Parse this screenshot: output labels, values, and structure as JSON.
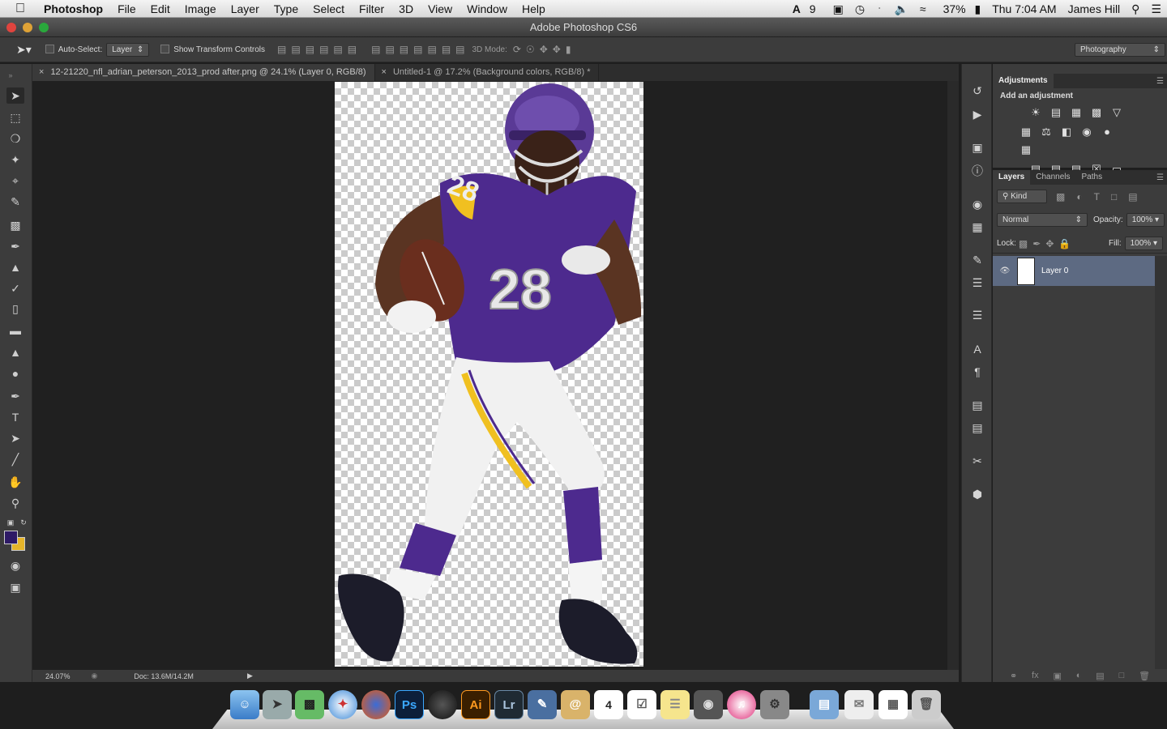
{
  "menubar": {
    "app": "Photoshop",
    "items": [
      "File",
      "Edit",
      "Image",
      "Layer",
      "Type",
      "Select",
      "Filter",
      "3D",
      "View",
      "Window",
      "Help"
    ],
    "status_badge": "9",
    "battery": "37%",
    "clock": "Thu 7:04 AM",
    "user": "James Hill"
  },
  "window": {
    "title": "Adobe Photoshop CS6"
  },
  "options": {
    "auto_select_label": "Auto-Select:",
    "auto_select_value": "Layer",
    "transform_label": "Show Transform Controls",
    "mode3d_label": "3D Mode:",
    "workspace": "Photography"
  },
  "tabs": [
    {
      "label": "12-21220_nfl_adrian_peterson_2013_prod after.png @ 24.1% (Layer 0, RGB/8)"
    },
    {
      "label": "Untitled-1 @ 17.2% (Background colors, RGB/8) *"
    }
  ],
  "status": {
    "zoom": "24.07%",
    "doc": "Doc: 13.6M/14.2M"
  },
  "adjustments": {
    "tab": "Adjustments",
    "hint": "Add an adjustment"
  },
  "layers": {
    "tabs": [
      "Layers",
      "Channels",
      "Paths"
    ],
    "kind": "Kind",
    "blend": "Normal",
    "opacity_label": "Opacity:",
    "opacity": "100%",
    "lock_label": "Lock:",
    "fill_label": "Fill:",
    "fill": "100%",
    "layer_name": "Layer 0"
  },
  "colors": {
    "foreground": "#2e1a66",
    "background": "#e6b52a"
  },
  "dock": [
    {
      "name": "Finder"
    },
    {
      "name": "Launchpad"
    },
    {
      "name": "Photo Browser"
    },
    {
      "name": "Safari"
    },
    {
      "name": "Firefox"
    },
    {
      "name": "Ps"
    },
    {
      "name": "Aperture"
    },
    {
      "name": "Ai"
    },
    {
      "name": "Lr"
    },
    {
      "name": "Preview"
    },
    {
      "name": "Mail"
    },
    {
      "name": "4"
    },
    {
      "name": "Reminders"
    },
    {
      "name": "Notes"
    },
    {
      "name": "FaceTime"
    },
    {
      "name": "iTunes"
    },
    {
      "name": "System Preferences"
    },
    {
      "name": "Folder"
    },
    {
      "name": "Mail Stack"
    },
    {
      "name": "Calendar Stack"
    },
    {
      "name": "Trash"
    }
  ]
}
